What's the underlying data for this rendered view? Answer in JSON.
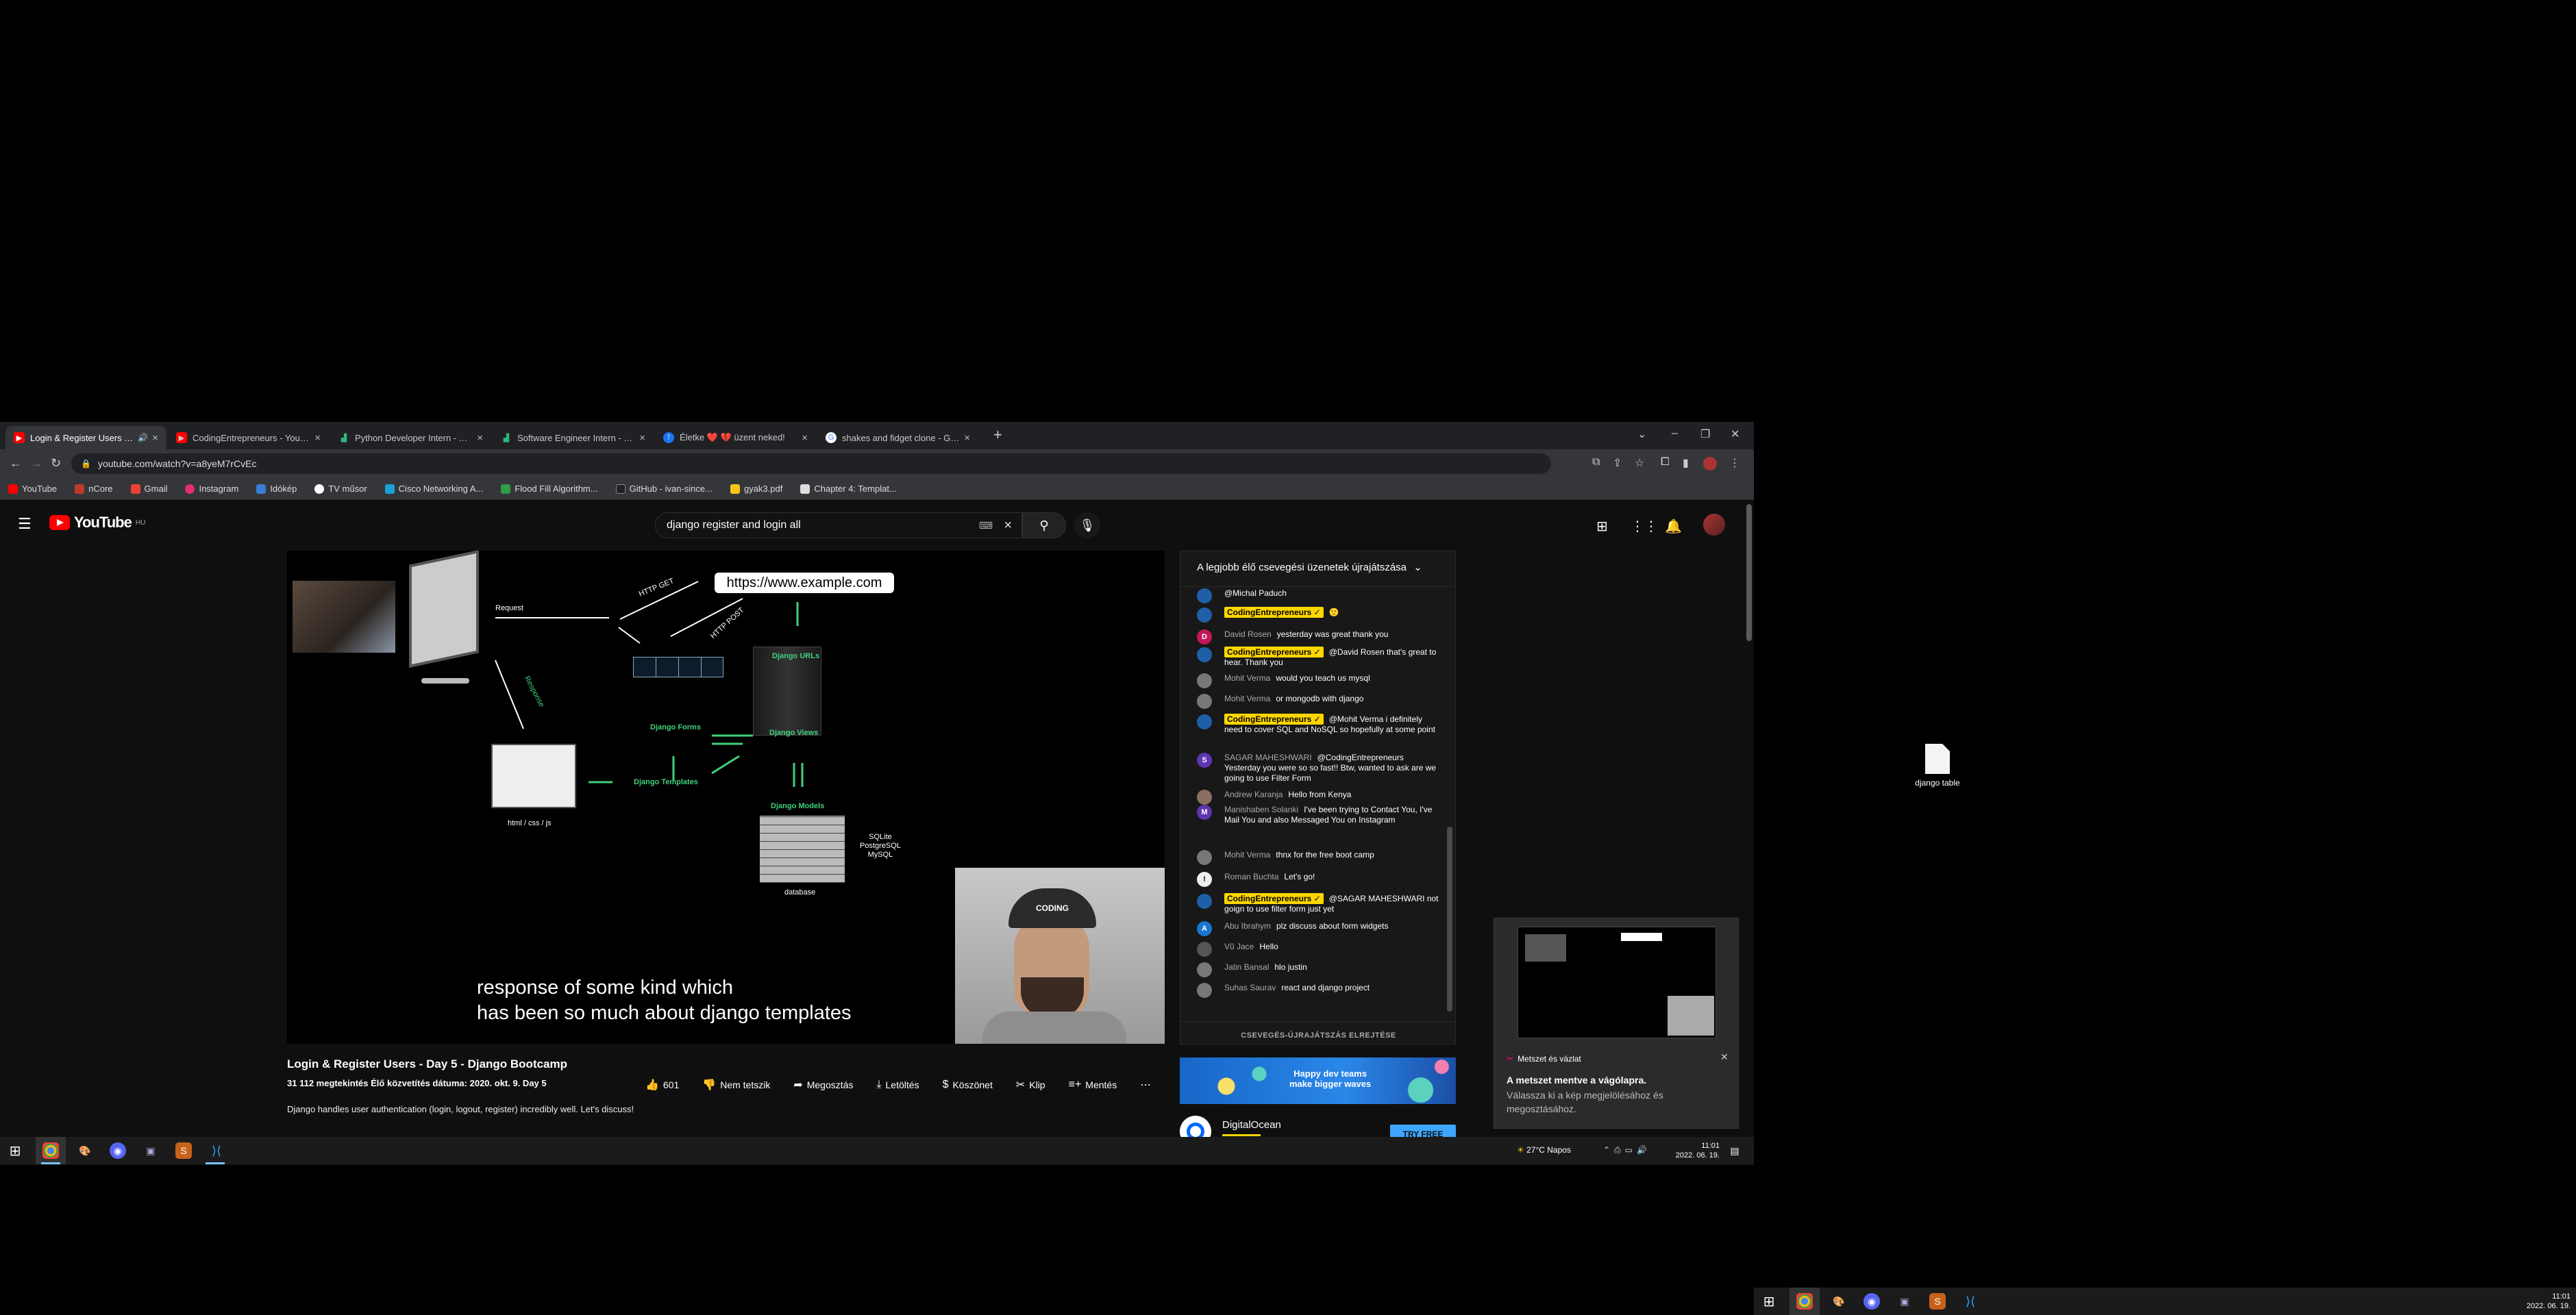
{
  "browser": {
    "tabs": [
      {
        "title": "Login & Register Users - Day...",
        "active": true,
        "icon": "youtube-icon",
        "color": "#ff0000"
      },
      {
        "title": "CodingEntrepreneurs - YouTube",
        "active": false,
        "icon": "youtube-icon",
        "color": "#ff0000"
      },
      {
        "title": "Python Developer Intern - Almá...",
        "active": false,
        "icon": "chart-icon",
        "color": "#2db87d"
      },
      {
        "title": "Software Engineer Intern - Data...",
        "active": false,
        "icon": "chart-icon",
        "color": "#2db87d"
      },
      {
        "title": "Életke ❤️ 💔 üzent neked!",
        "active": false,
        "icon": "facebook-icon",
        "color": "#1877f2"
      },
      {
        "title": "shakes and fidget clone - Googl...",
        "active": false,
        "icon": "google-icon",
        "color": "#ffffff"
      }
    ],
    "url": "youtube.com/watch?v=a8yeM7rCvEc",
    "bookmarks": [
      {
        "label": "YouTube",
        "color": "#ff0000"
      },
      {
        "label": "nCore",
        "color": "#c0392b"
      },
      {
        "label": "Gmail",
        "color": "#ea4335"
      },
      {
        "label": "Instagram",
        "color": "#e1306c"
      },
      {
        "label": "Idókép",
        "color": "#3a7bd5"
      },
      {
        "label": "TV műsor",
        "color": "#ffffff"
      },
      {
        "label": "Cisco Networking A...",
        "color": "#1ba0d7"
      },
      {
        "label": "Flood Fill Algorithm...",
        "color": "#2f9e44"
      },
      {
        "label": "GitHub - ivan-since...",
        "color": "#222222"
      },
      {
        "label": "gyak3.pdf",
        "color": "#f5c518"
      },
      {
        "label": "Chapter 4: Templat...",
        "color": "#dddddd"
      }
    ]
  },
  "youtube": {
    "logo_text": "YouTube",
    "logo_region": "HU",
    "search_query": "django register and login all",
    "video": {
      "url_pill": "https://www.example.com",
      "labels": {
        "request": "Request",
        "http_get": "HTTP GET",
        "http_post": "HTTP POST",
        "response": "Response",
        "django_urls": "Django URLs",
        "django_forms": "Django Forms",
        "django_views": "Django Views",
        "django_templates": "Django Templates",
        "django_models": "Django Models",
        "html_css_js": "html / css / js",
        "db_list": "SQLite\nPostgreSQL\nMySQL",
        "database": "database"
      },
      "subtitle_line1": "response of some kind which",
      "subtitle_line2": "has been so much about django templates",
      "cap_text": "CODING"
    },
    "title": "Login & Register Users - Day 5 - Django Bootcamp",
    "meta": "31 112 megtekintés  Élő közvetítés dátuma: 2020. okt. 9.  Day 5",
    "description": "Django handles user authentication (login, logout, register) incredibly well. Let's discuss!",
    "actions": {
      "likes": "601",
      "dislike": "Nem tetszik",
      "share": "Megosztás",
      "download": "Letöltés",
      "thanks": "Köszönet",
      "clip": "Klip",
      "save": "Mentés"
    }
  },
  "chat": {
    "header": "A legjobb élő csevegési üzenetek újrajátszása",
    "hide_label": "CSEVEGÉS-ÚJRAJÁTSZÁS ELREJTÉSE",
    "messages": [
      {
        "author": "",
        "text": "@Michal Paduch",
        "own": false,
        "initial": "",
        "color": "#1e5fa8"
      },
      {
        "author": "CodingEntrepreneurs ✓",
        "text": "🙂",
        "own": true,
        "initial": "",
        "color": "#1e5fa8"
      },
      {
        "author": "David Rosen",
        "text": "yesterday was great thank you",
        "own": false,
        "initial": "D",
        "color": "#c2185b"
      },
      {
        "author": "CodingEntrepreneurs ✓",
        "text": "@David Rosen that's great to hear. Thank you",
        "own": true,
        "initial": "",
        "color": "#1e5fa8"
      },
      {
        "author": "Mohit Verma",
        "text": "would you teach us mysql",
        "own": false,
        "initial": "",
        "color": "#777777"
      },
      {
        "author": "Mohit Verma",
        "text": "or mongodb with django",
        "own": false,
        "initial": "",
        "color": "#777777"
      },
      {
        "author": "CodingEntrepreneurs ✓",
        "text": "@Mohit Verma i definitely need to cover SQL and NoSQL so hopefully at some point",
        "own": true,
        "initial": "",
        "color": "#1e5fa8"
      },
      {
        "author": "SAGAR MAHESHWARI",
        "text": "@CodingEntrepreneurs Yesterday you were so so fast!! Btw, wanted to ask are we going to use Filter Form",
        "own": false,
        "initial": "S",
        "color": "#5e35b1"
      },
      {
        "author": "Andrew Karanja",
        "text": "Hello from Kenya",
        "own": false,
        "initial": "",
        "color": "#8d6e63"
      },
      {
        "author": "Manishaben Solanki",
        "text": "I've been trying to Contact You, I've Mail You and also Messaged You on Instagram",
        "own": false,
        "initial": "M",
        "color": "#5e35b1"
      },
      {
        "author": "Mohit Verma",
        "text": "thnx for the free boot camp",
        "own": false,
        "initial": "",
        "color": "#777777"
      },
      {
        "author": "Roman Buchta",
        "text": "Let's go!",
        "own": false,
        "initial": "!",
        "color": "#eeeeee"
      },
      {
        "author": "CodingEntrepreneurs ✓",
        "text": "@SAGAR MAHESHWARI not goign to use filter form just yet",
        "own": true,
        "initial": "",
        "color": "#1e5fa8"
      },
      {
        "author": "Abu Ibrahym",
        "text": "plz discuss about form widgets",
        "own": false,
        "initial": "A",
        "color": "#1976d2"
      },
      {
        "author": "Vũ Jace",
        "text": "Hello",
        "own": false,
        "initial": "",
        "color": "#555555"
      },
      {
        "author": "Jatin Bansal",
        "text": "hlo justin",
        "own": false,
        "initial": "",
        "color": "#777777"
      },
      {
        "author": "Suhas Saurav",
        "text": "react and django project",
        "own": false,
        "initial": "",
        "color": "#777777"
      }
    ]
  },
  "ad": {
    "banner_text": "Happy dev teams\nmake bigger waves",
    "brand": "DigitalOcean",
    "cta": "TRY FREE"
  },
  "snip": {
    "app": "Metszet és vázlat",
    "title": "A metszet mentve a vágólapra.",
    "body": "Válassza ki a kép megjelölésához és megosztásához."
  },
  "desktop": {
    "file_label": "django table"
  },
  "taskbar": {
    "weather": "27°C  Napos",
    "time": "11:01",
    "date": "2022. 06. 19.",
    "time2": "11:01",
    "date2": "2022. 06. 19."
  }
}
